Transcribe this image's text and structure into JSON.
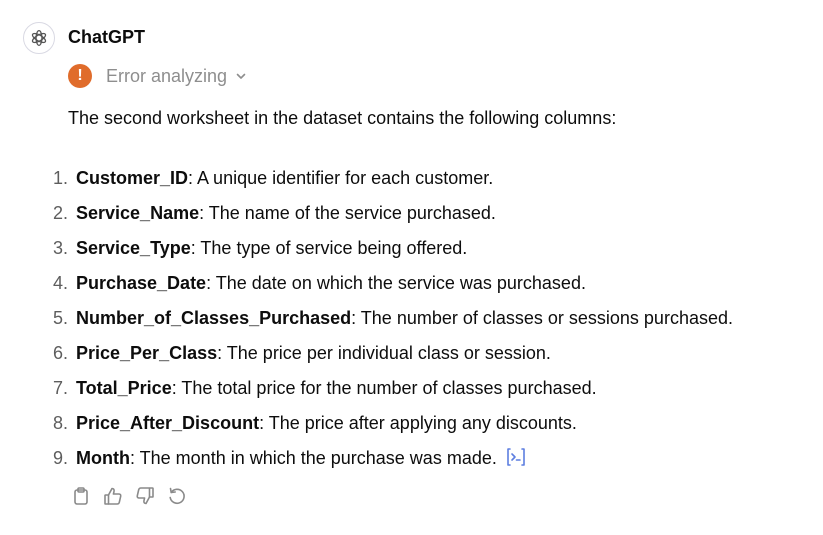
{
  "message": {
    "author": "ChatGPT",
    "avatar_icon": "openai-logo-icon",
    "status": {
      "icon": "exclamation-icon",
      "text": "Error analyzing",
      "color": "#e06c2b"
    },
    "intro": "The second worksheet in the dataset contains the following columns:",
    "columns": [
      {
        "num": "1.",
        "name": "Customer_ID",
        "desc": ": A unique identifier for each customer."
      },
      {
        "num": "2.",
        "name": "Service_Name",
        "desc": ": The name of the service purchased."
      },
      {
        "num": "3.",
        "name": "Service_Type",
        "desc": ": The type of service being offered."
      },
      {
        "num": "4.",
        "name": "Purchase_Date",
        "desc": ": The date on which the service was purchased."
      },
      {
        "num": "5.",
        "name": "Number_of_Classes_Purchased",
        "desc": ": The number of classes or sessions purchased."
      },
      {
        "num": "6.",
        "name": "Price_Per_Class",
        "desc": ": The price per individual class or session."
      },
      {
        "num": "7.",
        "name": "Total_Price",
        "desc": ": The total price for the number of classes purchased."
      },
      {
        "num": "8.",
        "name": "Price_After_Discount",
        "desc": ": The price after applying any discounts."
      },
      {
        "num": "9.",
        "name": "Month",
        "desc": ": The month in which the purchase was made."
      }
    ],
    "actions": [
      "copy-icon",
      "thumbs-up-icon",
      "thumbs-down-icon",
      "regenerate-icon"
    ]
  }
}
